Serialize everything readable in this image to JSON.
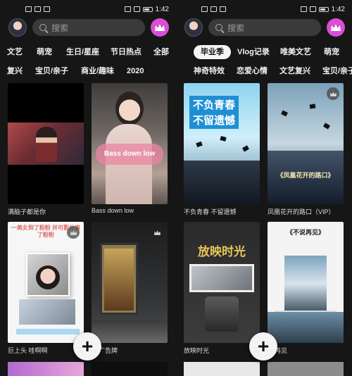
{
  "status": {
    "time": "1:42"
  },
  "search": {
    "placeholder": "搜索"
  },
  "left": {
    "tabs_row1": [
      "文艺",
      "萌宠",
      "生日/星座",
      "节日热点",
      "全部"
    ],
    "tabs_row2": [
      "复兴",
      "宝贝/亲子",
      "商业/趣味",
      "2020"
    ],
    "cards": [
      {
        "title": "满脑子都是你",
        "overlay": ""
      },
      {
        "title": "Bass down low",
        "overlay": "Bass down low"
      },
      {
        "title": "巨上头 哇啊啊",
        "overlay": "一美女到了粉粉 并可影分事了粉粉"
      },
      {
        "title": "广告牌",
        "overlay": ""
      }
    ]
  },
  "right": {
    "tabs_row1": [
      "毕业季",
      "Vlog记录",
      "唯美文艺",
      "萌宠"
    ],
    "tabs_row2": [
      "神奇特效",
      "恋爱心情",
      "文艺复兴",
      "宝贝/亲子"
    ],
    "active_tab": "毕业季",
    "cards": [
      {
        "title": "不负青春 不留遗憾",
        "overlay1": "不负青春",
        "overlay2": "不留遗憾"
      },
      {
        "title": "凤凰花开的路口（VIP）",
        "overlay": "《凤凰花开的路口》"
      },
      {
        "title": "放映时光",
        "overlay": "放映时光"
      },
      {
        "title": "再见",
        "overlay": "《不说再见》"
      }
    ]
  },
  "fab": {
    "label": "+"
  },
  "colors": {
    "accent": "#d94fd6",
    "background": "#161616",
    "search_bg": "#3a3a3d"
  }
}
